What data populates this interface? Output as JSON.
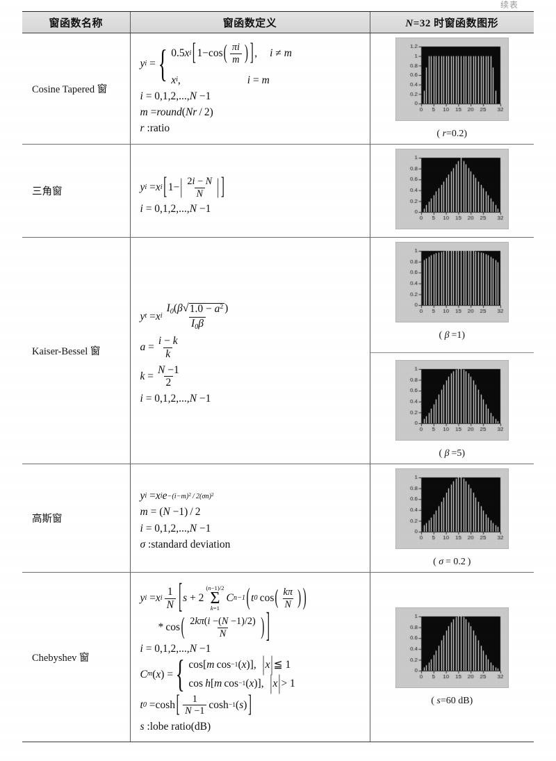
{
  "page": {
    "continued_label": "续表"
  },
  "table": {
    "headers": [
      {
        "label": "窗函数名称",
        "name": "window-name"
      },
      {
        "label": "窗函数定义",
        "name": "window-definition"
      },
      {
        "label_parts": {
          "n": "N",
          "rest": "=32 时窗函数图形"
        },
        "label": "N=32 时窗函数图形",
        "name": "window-plot"
      }
    ],
    "rows": [
      {
        "name": "Cosine Tapered 窗",
        "id": "cosine-tapered",
        "definition_lines": [
          "y_i = { 0.5x_i[1 - cos(πi/m)],  i ≠ m ;  x_i,  i = m }",
          "i = 0,1,2,...,N-1",
          "m = round(Nr/2)",
          "r : ratio"
        ],
        "figures": [
          {
            "caption": "( r =0.2)",
            "param_symbol": "r",
            "param_value": "=0.2"
          }
        ]
      },
      {
        "name": "三角窗",
        "id": "triangular",
        "definition_lines": [
          "y_i = x_i[1 - |(2i - N)/N|]",
          "i = 0,1,2,...,N-1"
        ],
        "figures": [
          {
            "caption": "",
            "param_symbol": "",
            "param_value": ""
          }
        ]
      },
      {
        "name": "Kaiser-Bessel 窗",
        "id": "kaiser-bessel",
        "definition_lines": [
          "y_i = x_i · I_0(β√(1.0 - a²)) / (I_0 β)",
          "a = (i - k)/k",
          "k = (N - 1)/2",
          "i = 0,1,2,...,N-1"
        ],
        "figures": [
          {
            "caption": "( β =1)",
            "param_symbol": "β",
            "param_value": "=1"
          },
          {
            "caption": "( β =5)",
            "param_symbol": "β",
            "param_value": "=5"
          }
        ]
      },
      {
        "name": "高斯窗",
        "id": "gaussian",
        "definition_lines": [
          "y_i = x_i e^(-(i-m)²/2(σn)²)",
          "m = (N - 1)/2",
          "i = 0,1,2,...,N-1",
          "σ : standard deviation"
        ],
        "figures": [
          {
            "caption": "( σ = 0.2 )",
            "param_symbol": "σ",
            "param_value": "= 0.2"
          }
        ]
      },
      {
        "name": "Chebyshev 窗",
        "id": "chebyshev",
        "definition_lines": [
          "y_i = x_i (1/N)[ s + 2 Σ_{k=1}^{(n-1)/2} C_{n-1}( t_0 cos(kπ/N) ) * cos( 2kπ(i-(N-1)/2)/N ) ]",
          "i = 0,1,2,...,N-1",
          "C_m(x) = { cos[m cos⁻¹(x)], |x| ≤ 1 ; cos h[m cos⁻¹(x)], |x| > 1 }",
          "t_0 = cosh[ (1/(N-1)) cosh⁻¹(s) ]",
          "s : lobe ratio(dB)"
        ],
        "figures": [
          {
            "caption": "( s =60 dB)",
            "param_symbol": "s",
            "param_value": "=60 dB"
          }
        ]
      }
    ]
  },
  "chart_data": [
    {
      "type": "bar",
      "id": "cosine-tapered-plot",
      "title": "",
      "xlabel": "",
      "ylabel": "",
      "xticks": [
        0,
        5,
        10,
        15,
        20,
        25,
        32
      ],
      "yticks": [
        0,
        0.2,
        0.4,
        0.6,
        0.8,
        1,
        1.2
      ],
      "xlim": [
        0,
        32
      ],
      "ylim": [
        0,
        1.2
      ],
      "grid": false,
      "window": "cosine_tapered",
      "param": 0.2,
      "n": 32,
      "values": [
        0.0,
        0.27,
        0.76,
        1.0,
        1.0,
        1.0,
        1.0,
        1.0,
        1.0,
        1.0,
        1.0,
        1.0,
        1.0,
        1.0,
        1.0,
        1.0,
        1.0,
        1.0,
        1.0,
        1.0,
        1.0,
        1.0,
        1.0,
        1.0,
        1.0,
        1.0,
        1.0,
        1.0,
        1.0,
        0.76,
        0.27,
        0.0
      ]
    },
    {
      "type": "bar",
      "id": "triangular-plot",
      "title": "",
      "xlabel": "",
      "ylabel": "",
      "xticks": [
        0,
        5,
        10,
        15,
        20,
        25,
        32
      ],
      "yticks": [
        0,
        0.2,
        0.4,
        0.6,
        0.8,
        1
      ],
      "xlim": [
        0,
        32
      ],
      "ylim": [
        0,
        1.0
      ],
      "grid": false,
      "window": "triangular",
      "n": 32,
      "values": [
        0.0,
        0.06,
        0.13,
        0.19,
        0.25,
        0.31,
        0.38,
        0.44,
        0.5,
        0.56,
        0.63,
        0.69,
        0.75,
        0.81,
        0.88,
        0.94,
        1.0,
        0.94,
        0.88,
        0.81,
        0.75,
        0.69,
        0.63,
        0.56,
        0.5,
        0.44,
        0.38,
        0.31,
        0.25,
        0.19,
        0.13,
        0.06
      ]
    },
    {
      "type": "bar",
      "id": "kaiser-beta1-plot",
      "title": "",
      "xlabel": "",
      "ylabel": "",
      "xticks": [
        0,
        5,
        10,
        15,
        20,
        25,
        32
      ],
      "yticks": [
        0,
        0.2,
        0.4,
        0.6,
        0.8,
        1
      ],
      "xlim": [
        0,
        32
      ],
      "ylim": [
        0,
        1.0
      ],
      "grid": false,
      "window": "kaiser",
      "param": 1,
      "n": 32,
      "values": [
        0.79,
        0.83,
        0.86,
        0.89,
        0.92,
        0.94,
        0.96,
        0.97,
        0.98,
        0.99,
        1.0,
        1.0,
        1.0,
        1.0,
        1.0,
        1.0,
        1.0,
        1.0,
        1.0,
        1.0,
        1.0,
        1.0,
        0.99,
        0.98,
        0.97,
        0.96,
        0.94,
        0.92,
        0.89,
        0.86,
        0.83,
        0.79
      ]
    },
    {
      "type": "bar",
      "id": "kaiser-beta5-plot",
      "title": "",
      "xlabel": "",
      "ylabel": "",
      "xticks": [
        0,
        5,
        10,
        15,
        20,
        25,
        32
      ],
      "yticks": [
        0,
        0.2,
        0.4,
        0.6,
        0.8,
        1
      ],
      "xlim": [
        0,
        32
      ],
      "ylim": [
        0,
        1.0
      ],
      "grid": false,
      "window": "kaiser",
      "param": 5,
      "n": 32,
      "values": [
        0.04,
        0.08,
        0.13,
        0.19,
        0.27,
        0.35,
        0.44,
        0.53,
        0.62,
        0.71,
        0.79,
        0.86,
        0.92,
        0.96,
        0.99,
        1.0,
        1.0,
        0.99,
        0.96,
        0.92,
        0.86,
        0.79,
        0.71,
        0.62,
        0.53,
        0.44,
        0.35,
        0.27,
        0.19,
        0.13,
        0.08,
        0.04
      ]
    },
    {
      "type": "bar",
      "id": "gaussian-plot",
      "title": "",
      "xlabel": "",
      "ylabel": "",
      "xticks": [
        0,
        5,
        10,
        15,
        20,
        25,
        32
      ],
      "yticks": [
        0,
        0.2,
        0.4,
        0.6,
        0.8,
        1
      ],
      "xlim": [
        0,
        32
      ],
      "ylim": [
        0,
        1.0
      ],
      "grid": false,
      "window": "gaussian",
      "param": 0.2,
      "n": 32,
      "values": [
        0.09,
        0.12,
        0.16,
        0.21,
        0.26,
        0.32,
        0.39,
        0.47,
        0.55,
        0.63,
        0.72,
        0.8,
        0.87,
        0.93,
        0.98,
        1.0,
        1.0,
        0.98,
        0.93,
        0.87,
        0.8,
        0.72,
        0.63,
        0.55,
        0.47,
        0.39,
        0.32,
        0.26,
        0.21,
        0.16,
        0.12,
        0.09
      ]
    },
    {
      "type": "bar",
      "id": "chebyshev-plot",
      "title": "",
      "xlabel": "",
      "ylabel": "",
      "xticks": [
        0,
        5,
        10,
        15,
        20,
        25,
        32
      ],
      "yticks": [
        0,
        0.2,
        0.4,
        0.6,
        0.8,
        1
      ],
      "xlim": [
        0,
        32
      ],
      "ylim": [
        0,
        1.0
      ],
      "grid": false,
      "window": "chebyshev",
      "param": 60,
      "n": 32,
      "values": [
        0.04,
        0.06,
        0.1,
        0.15,
        0.21,
        0.29,
        0.37,
        0.46,
        0.56,
        0.65,
        0.74,
        0.82,
        0.89,
        0.95,
        0.99,
        1.0,
        1.0,
        0.99,
        0.95,
        0.89,
        0.82,
        0.74,
        0.65,
        0.56,
        0.46,
        0.37,
        0.29,
        0.21,
        0.15,
        0.1,
        0.06,
        0.04
      ]
    }
  ]
}
